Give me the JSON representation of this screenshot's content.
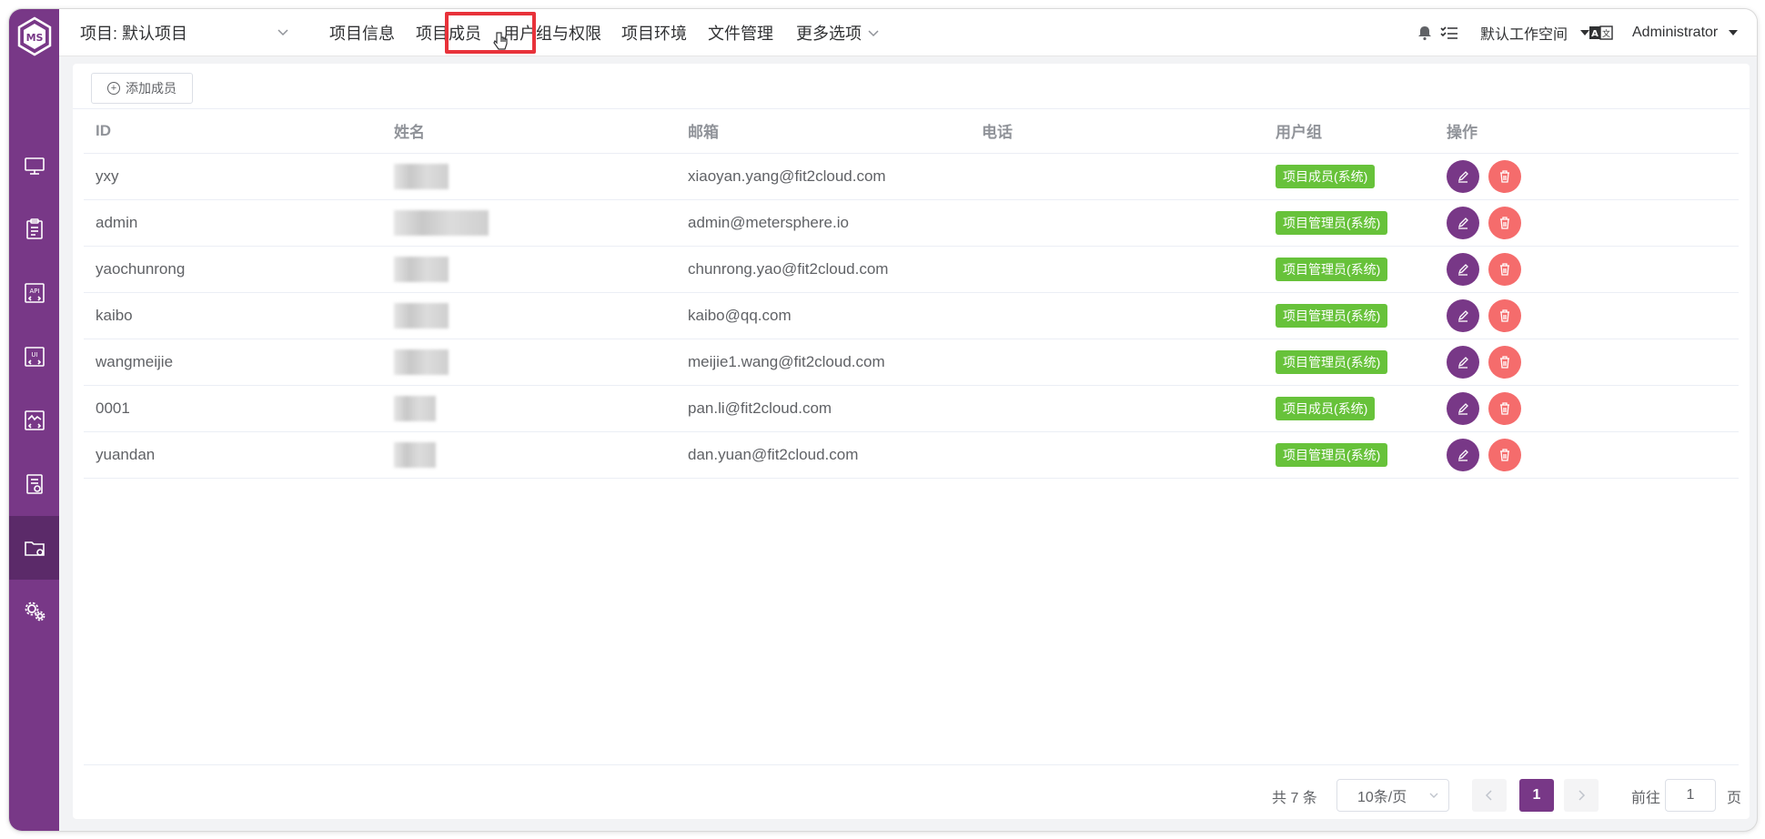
{
  "header": {
    "project_label": "项目: 默认项目",
    "nav": [
      "项目信息",
      "项目成员",
      "用户组与权限",
      "项目环境",
      "文件管理",
      "更多选项"
    ],
    "workspace": "默认工作空间",
    "user": "Administrator"
  },
  "sidebar": {
    "logo_text": "MS",
    "items": [
      "monitor-icon",
      "clipboard-icon",
      "api-icon",
      "ui-icon",
      "performance-icon",
      "report-icon",
      "project-folder-icon",
      "settings-icon"
    ],
    "active_index": 6
  },
  "toolbar": {
    "add_member_label": "添加成员"
  },
  "table": {
    "columns": [
      "ID",
      "姓名",
      "邮箱",
      "电话",
      "用户组",
      "操作"
    ],
    "rows": [
      {
        "id": "yxy",
        "email": "xiaoyan.yang@fit2cloud.com",
        "phone": "",
        "group": "项目成员(系统)"
      },
      {
        "id": "admin",
        "email": "admin@metersphere.io",
        "phone": "",
        "group": "项目管理员(系统)"
      },
      {
        "id": "yaochunrong",
        "email": "chunrong.yao@fit2cloud.com",
        "phone": "",
        "group": "项目管理员(系统)"
      },
      {
        "id": "kaibo",
        "email": "kaibo@qq.com",
        "phone": "",
        "group": "项目管理员(系统)"
      },
      {
        "id": "wangmeijie",
        "email": "meijie1.wang@fit2cloud.com",
        "phone": "",
        "group": "项目管理员(系统)"
      },
      {
        "id": "0001",
        "email": "pan.li@fit2cloud.com",
        "phone": "",
        "group": "项目成员(系统)"
      },
      {
        "id": "yuandan",
        "email": "dan.yuan@fit2cloud.com",
        "phone": "",
        "group": "项目管理员(系统)"
      }
    ]
  },
  "pagination": {
    "total_text": "共 7 条",
    "page_size": "10条/页",
    "current_page": "1",
    "goto_label": "前往",
    "goto_value": "1",
    "page_suffix": "页"
  },
  "colors": {
    "brand": "#783887",
    "tag_green": "#67c23a",
    "danger": "#f56c6c",
    "highlight": "#e8323a"
  }
}
